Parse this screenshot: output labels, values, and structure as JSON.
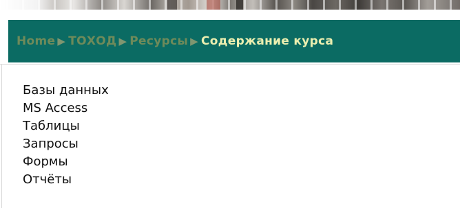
{
  "breadcrumb": {
    "items": [
      {
        "label": "Home"
      },
      {
        "label": "ТОХОД"
      },
      {
        "label": "Ресурсы"
      }
    ],
    "separator": "▶",
    "current": "Содержание курса"
  },
  "course_contents": [
    "Базы данных",
    "MS Access",
    "Таблицы",
    "Запросы",
    "Формы",
    "Отчёты"
  ],
  "colors": {
    "nav_background": "#0b6b63",
    "crumb_link": "#6e8a5a",
    "crumb_current": "#ecefb0",
    "text": "#111111"
  }
}
